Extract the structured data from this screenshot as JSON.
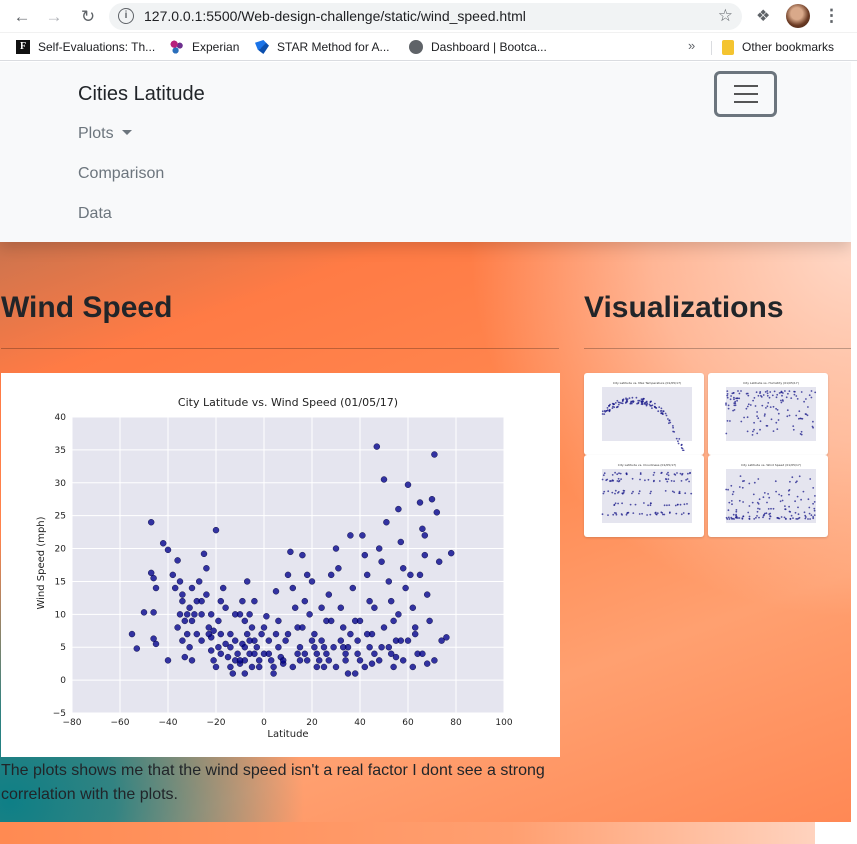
{
  "browser": {
    "url": "127.0.0.1:5500/Web-design-challenge/static/wind_speed.html",
    "bookmarks": [
      "Self-Evaluations: Th...",
      "Experian",
      "STAR Method for A...",
      "Dashboard | Bootca..."
    ],
    "more": "»",
    "other_bookmarks": "Other bookmarks"
  },
  "navbar": {
    "brand": "Cities Latitude",
    "links": [
      "Plots",
      "Comparison",
      "Data"
    ]
  },
  "content": {
    "title": "Wind Speed",
    "caption": "The plots shows me that the wind speed isn't a real factor I dont see a strong correlation with the plots."
  },
  "sidebar": {
    "title": "Visualizations"
  },
  "chart_data": {
    "type": "scatter",
    "title": "City Latitude vs. Wind Speed (01/05/17)",
    "xlabel": "Latitude",
    "ylabel": "Wind Speed (mph)",
    "xlim": [
      -80,
      100
    ],
    "ylim": [
      -5,
      40
    ],
    "xticks": [
      -80,
      -60,
      -40,
      -20,
      0,
      20,
      40,
      60,
      80,
      100
    ],
    "yticks": [
      -5,
      0,
      5,
      10,
      15,
      20,
      25,
      30,
      35,
      40
    ],
    "grid": true,
    "series": [
      {
        "color": "#00008b",
        "points": [
          [
            -55,
            7
          ],
          [
            -53,
            4.8
          ],
          [
            -50,
            10.3
          ],
          [
            -47,
            24
          ],
          [
            -46,
            15.5
          ],
          [
            -46,
            6.3
          ],
          [
            -45,
            5.5
          ],
          [
            -42,
            20.8
          ],
          [
            -40,
            19.8
          ],
          [
            -40,
            3
          ],
          [
            -46,
            10.3
          ],
          [
            -45,
            14
          ],
          [
            -47,
            16.3
          ],
          [
            -36,
            18.2
          ],
          [
            -35,
            15
          ],
          [
            -34,
            12
          ],
          [
            -33,
            9
          ],
          [
            -32,
            7
          ],
          [
            -31,
            5
          ],
          [
            -30,
            3
          ],
          [
            -38,
            16
          ],
          [
            -37,
            14
          ],
          [
            -35,
            10
          ],
          [
            -34,
            13
          ],
          [
            -33,
            3.5
          ],
          [
            -31,
            11
          ],
          [
            -29,
            10
          ],
          [
            -28,
            12
          ],
          [
            -27,
            15
          ],
          [
            -26,
            6
          ],
          [
            -25,
            19.2
          ],
          [
            -24,
            17
          ],
          [
            -23,
            8
          ],
          [
            -22,
            6.5
          ],
          [
            -21,
            7.5
          ],
          [
            -20,
            22.8
          ],
          [
            -19,
            9
          ],
          [
            -18,
            4
          ],
          [
            -17,
            14
          ],
          [
            -16,
            11
          ],
          [
            -24,
            13
          ],
          [
            -23,
            7
          ],
          [
            -22,
            4.5
          ],
          [
            -21,
            3
          ],
          [
            -20,
            2
          ],
          [
            -19,
            5
          ],
          [
            -18,
            7
          ],
          [
            -16,
            5.5
          ],
          [
            -15,
            3.5
          ],
          [
            -14,
            2
          ],
          [
            -13,
            1
          ],
          [
            -12,
            6
          ],
          [
            -11,
            4
          ],
          [
            -10,
            2.5
          ],
          [
            -9,
            5.5
          ],
          [
            -8,
            3
          ],
          [
            -7,
            7
          ],
          [
            -6,
            4
          ],
          [
            -5,
            2
          ],
          [
            -4,
            6
          ],
          [
            -10,
            10
          ],
          [
            -9,
            12
          ],
          [
            -8,
            9
          ],
          [
            -7,
            15
          ],
          [
            -6,
            10
          ],
          [
            -5,
            8
          ],
          [
            -4,
            12
          ],
          [
            -3,
            5
          ],
          [
            -2,
            3
          ],
          [
            -1,
            7
          ],
          [
            0,
            4
          ],
          [
            1,
            9.7
          ],
          [
            2,
            6
          ],
          [
            3,
            3
          ],
          [
            4,
            2
          ],
          [
            5,
            13.5
          ],
          [
            6,
            5
          ],
          [
            7,
            3.5
          ],
          [
            8,
            2.5
          ],
          [
            9,
            6
          ],
          [
            10,
            16
          ],
          [
            11,
            19.5
          ],
          [
            12,
            14
          ],
          [
            13,
            11
          ],
          [
            14,
            8
          ],
          [
            15,
            5
          ],
          [
            16,
            19
          ],
          [
            17,
            12
          ],
          [
            18,
            16
          ],
          [
            19,
            10
          ],
          [
            20,
            15
          ],
          [
            21,
            7
          ],
          [
            22,
            4
          ],
          [
            23,
            3
          ],
          [
            24,
            6
          ],
          [
            25,
            2
          ],
          [
            26,
            9
          ],
          [
            27,
            13
          ],
          [
            28,
            16
          ],
          [
            29,
            5
          ],
          [
            30,
            20
          ],
          [
            31,
            17
          ],
          [
            32,
            11
          ],
          [
            33,
            8
          ],
          [
            34,
            4
          ],
          [
            35,
            1
          ],
          [
            36,
            22
          ],
          [
            37,
            14
          ],
          [
            38,
            9
          ],
          [
            39,
            6
          ],
          [
            40,
            3
          ],
          [
            41,
            22
          ],
          [
            42,
            19
          ],
          [
            43,
            16
          ],
          [
            44,
            12
          ],
          [
            45,
            7
          ],
          [
            46,
            4
          ],
          [
            47,
            35.5
          ],
          [
            48,
            20
          ],
          [
            49,
            18
          ],
          [
            50,
            30.5
          ],
          [
            51,
            24
          ],
          [
            52,
            15
          ],
          [
            53,
            12
          ],
          [
            54,
            9
          ],
          [
            55,
            6
          ],
          [
            56,
            26
          ],
          [
            57,
            21
          ],
          [
            58,
            17
          ],
          [
            59,
            14
          ],
          [
            60,
            29.7
          ],
          [
            61,
            16
          ],
          [
            62,
            11
          ],
          [
            63,
            8
          ],
          [
            64,
            4
          ],
          [
            65,
            27
          ],
          [
            66,
            23
          ],
          [
            67,
            19
          ],
          [
            68,
            13
          ],
          [
            69,
            9
          ],
          [
            70,
            27.5
          ],
          [
            71,
            34.3
          ],
          [
            72,
            25.5
          ],
          [
            73,
            18
          ],
          [
            74,
            6
          ],
          [
            76,
            6.5
          ],
          [
            78,
            19.3
          ],
          [
            67,
            22
          ],
          [
            65,
            16
          ],
          [
            63,
            7
          ],
          [
            58,
            3
          ],
          [
            56,
            10
          ],
          [
            54,
            2
          ],
          [
            52,
            5
          ],
          [
            50,
            8
          ],
          [
            48,
            3
          ],
          [
            46,
            11
          ],
          [
            44,
            5
          ],
          [
            42,
            2
          ],
          [
            40,
            9
          ],
          [
            38,
            1
          ],
          [
            36,
            7
          ],
          [
            34,
            3
          ],
          [
            32,
            6
          ],
          [
            30,
            2
          ],
          [
            28,
            9
          ],
          [
            26,
            4
          ],
          [
            24,
            11
          ],
          [
            22,
            2
          ],
          [
            20,
            6
          ],
          [
            18,
            3
          ],
          [
            16,
            8
          ],
          [
            14,
            4
          ],
          [
            12,
            2
          ],
          [
            10,
            7
          ],
          [
            8,
            3
          ],
          [
            6,
            9
          ],
          [
            4,
            1
          ],
          [
            2,
            4
          ],
          [
            0,
            8
          ],
          [
            -2,
            2
          ],
          [
            -4,
            4
          ],
          [
            -6,
            6
          ],
          [
            -8,
            1
          ],
          [
            -12,
            3
          ],
          [
            -14,
            5
          ],
          [
            -26,
            10
          ],
          [
            -28,
            7
          ],
          [
            -30,
            14
          ],
          [
            -32,
            10
          ],
          [
            -36,
            8
          ],
          [
            -34,
            6
          ],
          [
            -30,
            9
          ],
          [
            -26,
            12
          ],
          [
            -22,
            10
          ],
          [
            -18,
            12
          ],
          [
            -14,
            7
          ],
          [
            -12,
            10
          ],
          [
            -10,
            3
          ],
          [
            -8,
            5
          ],
          [
            5,
            7
          ],
          [
            15,
            3
          ],
          [
            25,
            5
          ],
          [
            35,
            5
          ],
          [
            45,
            2.5
          ],
          [
            55,
            3.5
          ],
          [
            62,
            2
          ],
          [
            66,
            4
          ],
          [
            68,
            2.5
          ],
          [
            71,
            3
          ],
          [
            60,
            6
          ],
          [
            57,
            6
          ],
          [
            53,
            4
          ],
          [
            49,
            5
          ],
          [
            43,
            7
          ],
          [
            39,
            4
          ],
          [
            33,
            5
          ],
          [
            27,
            3
          ],
          [
            21,
            5
          ],
          [
            17,
            4
          ]
        ]
      }
    ]
  },
  "thumbnails": [
    {
      "title": "City Latitude vs. Max Temperature (01/05/17)",
      "kind": "temperature"
    },
    {
      "title": "City Latitude vs. Humidity (01/05/17)",
      "kind": "humidity"
    },
    {
      "title": "City Latitude vs. Cloudiness (01/05/17)",
      "kind": "cloudiness"
    },
    {
      "title": "City Latitude vs. Wind Speed (01/05/17)",
      "kind": "wind"
    }
  ]
}
